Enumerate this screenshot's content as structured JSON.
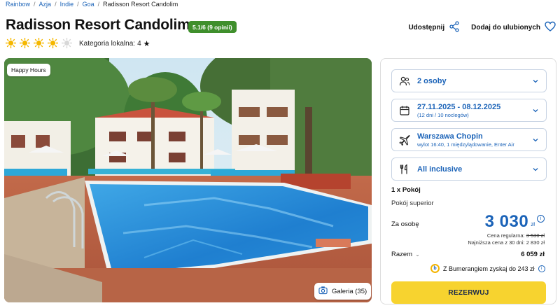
{
  "breadcrumb": [
    "Rainbow",
    "Azja",
    "Indie",
    "Goa",
    "Radisson Resort Candolim"
  ],
  "hotel": {
    "name": "Radisson Resort Candolim",
    "rating_badge": "5.1/6 (9 opinii)",
    "suns_filled": 4,
    "suns_total": 5,
    "category_label": "Kategoria lokalna:",
    "category_value": "4"
  },
  "actions": {
    "share_label": "Udostępnij",
    "favorite_label": "Dodaj do ulubionych"
  },
  "photo": {
    "tag": "Happy Hours",
    "gallery_label": "Galeria (35)"
  },
  "booking": {
    "guests": "2 osoby",
    "dates": "27.11.2025 - 08.12.2025",
    "dates_sub": "(12 dni / 10 noclegów)",
    "departure": "Warszawa Chopin",
    "departure_sub": "wylot 16:40, 1 międzylądowanie, Enter Air",
    "board": "All inclusive",
    "room_qty": "1 x Pokój",
    "room_type": "Pokój superior",
    "per_person_label": "Za osobę",
    "price": "3 030",
    "currency": "zł",
    "regular_label": "Cena regularna:",
    "regular_price": "3 530 zł",
    "lowest_label": "Najniższa cena z 30 dni: 2 830 zł",
    "total_label": "Razem",
    "total_value": "6 059 zł",
    "bumerang_text": "Z Bumerangiem zyskaj do 243 zł",
    "reserve_label": "REZERWUJ"
  },
  "colors": {
    "brand_blue": "#1b63b8",
    "badge_green": "#3f8f2c",
    "cta_yellow": "#f7d32f",
    "sun_yellow": "#f5b700"
  }
}
